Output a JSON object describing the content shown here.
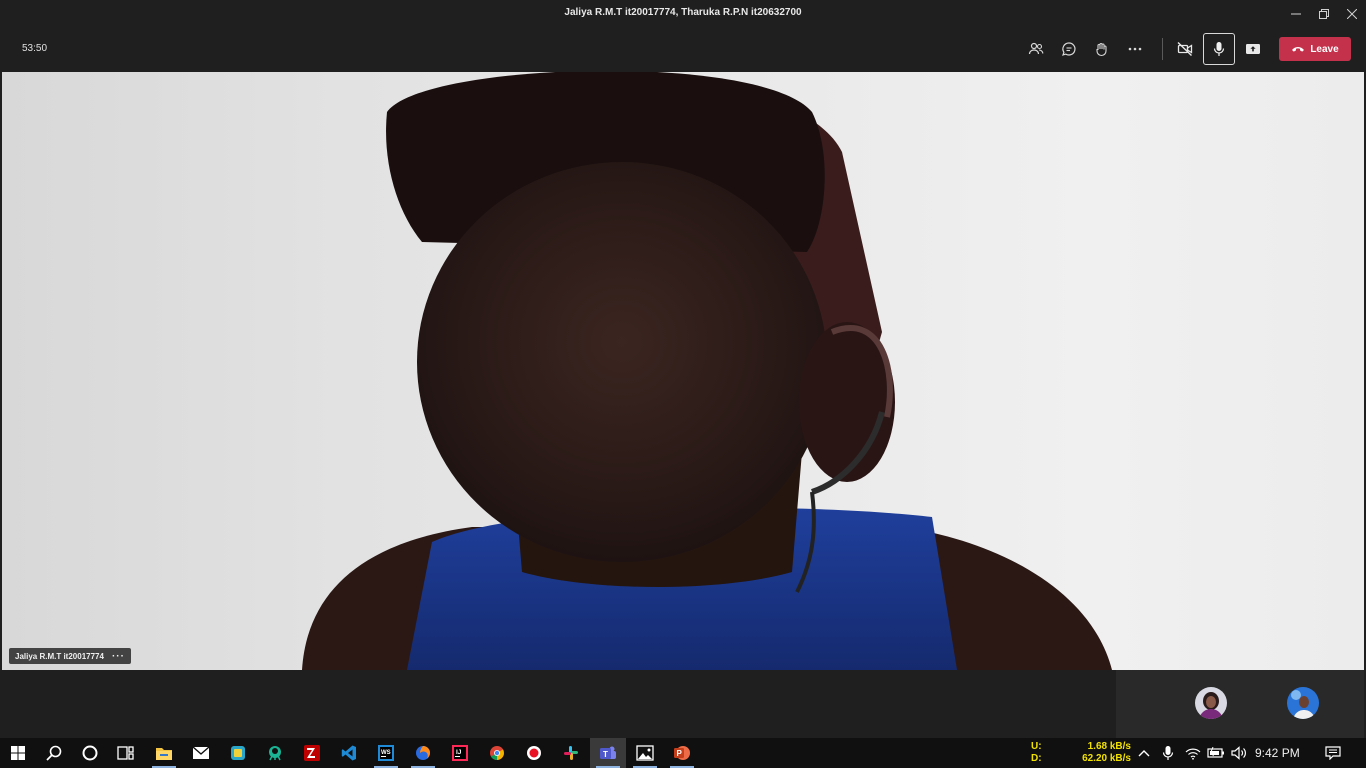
{
  "window": {
    "title": "Jaliya R.M.T it20017774, Tharuka R.P.N it20632700",
    "controls": [
      "minimize-icon",
      "restore-icon",
      "close-icon"
    ]
  },
  "meeting": {
    "timer": "53:50",
    "toolbar_icons": [
      "participants-icon",
      "chat-icon",
      "reactions-icon",
      "more-icon",
      "camera-off-icon",
      "microphone-icon",
      "share-screen-icon"
    ],
    "leave_label": "Leave",
    "leave_color": "#c4314b"
  },
  "video": {
    "speaker_name": "Jaliya R.M.T it20017774",
    "more_label": "···"
  },
  "participants": [
    "avatar-participant-1",
    "avatar-participant-2"
  ],
  "taskbar": {
    "apps": [
      "start-icon",
      "search-icon",
      "cortana-icon",
      "task-view-icon",
      "file-explorer-icon",
      "mail-icon",
      "sticky-app-icon",
      "gitkraken-icon",
      "filezilla-icon",
      "vscode-icon",
      "webstorm-icon",
      "firefox-icon",
      "intellij-icon",
      "chrome-icon",
      "recorder-icon",
      "slack-icon",
      "teams-icon",
      "photos-icon",
      "powerpoint-icon"
    ],
    "upload_label": "U:",
    "upload_value": "1.68 kB/s",
    "download_label": "D:",
    "download_value": "62.20 kB/s",
    "clock": "9:42 PM",
    "speed_color": "#f2e200"
  }
}
